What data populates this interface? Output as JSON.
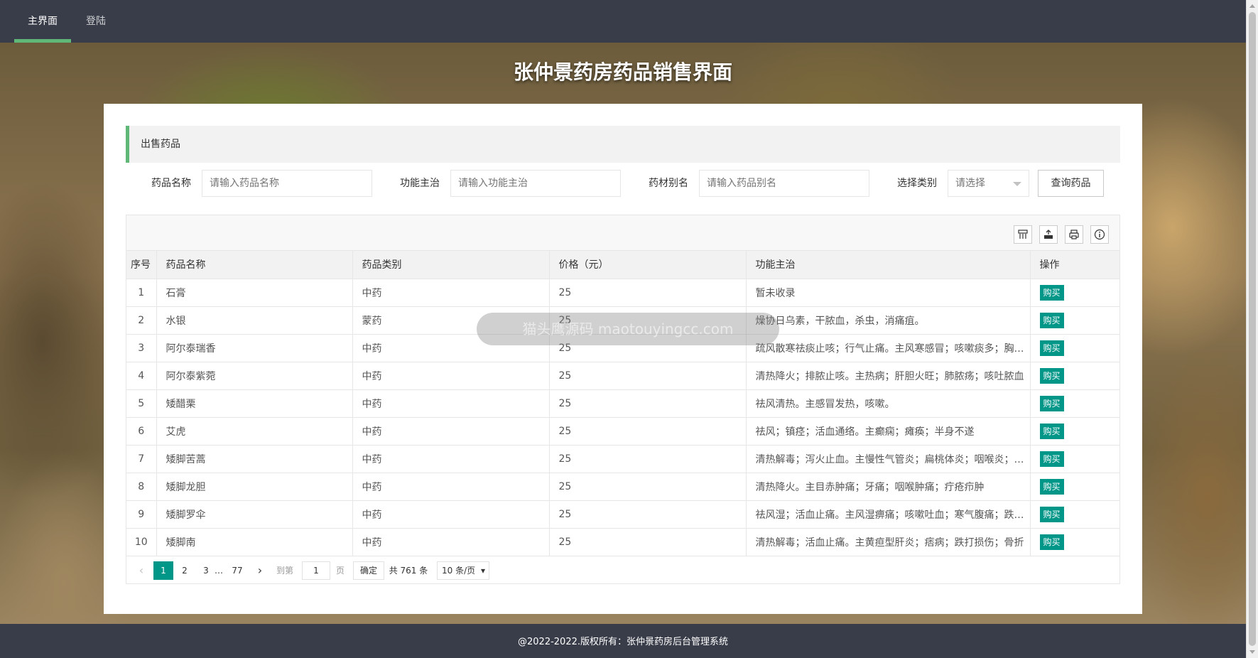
{
  "nav": {
    "items": [
      {
        "label": "主界面",
        "active": true
      },
      {
        "label": "登陆",
        "active": false
      }
    ],
    "active_color": "#5fb878"
  },
  "page": {
    "title": "张仲景药房药品销售界面"
  },
  "section": {
    "title": "出售药品"
  },
  "search": {
    "name_label": "药品名称",
    "name_placeholder": "请输入药品名称",
    "function_label": "功能主治",
    "function_placeholder": "请输入功能主治",
    "alias_label": "药材别名",
    "alias_placeholder": "请输入药品别名",
    "category_label": "选择类别",
    "category_value": "请选择",
    "query_button": "查询药品"
  },
  "toolbar": {
    "icons": [
      "columns-filter-icon",
      "export-icon",
      "print-icon",
      "info-icon"
    ]
  },
  "table": {
    "headers": [
      "序号",
      "药品名称",
      "药品类别",
      "价格（元）",
      "功能主治",
      "操作"
    ],
    "buy_label": "购买",
    "buy_color": "#009688",
    "rows": [
      {
        "no": "1",
        "name": "石膏",
        "category": "中药",
        "price": "25",
        "function": "暂未收录"
      },
      {
        "no": "2",
        "name": "水银",
        "category": "蒙药",
        "price": "25",
        "function": "燥协日乌素，干脓血，杀虫，消痛疽。"
      },
      {
        "no": "3",
        "name": "阿尔泰瑞香",
        "category": "中药",
        "price": "25",
        "function": "疏风散寒祛痰止咳；行气止痛。主风寒感冒；咳嗽痰多；胸胁胀痛"
      },
      {
        "no": "4",
        "name": "阿尔泰紫菀",
        "category": "中药",
        "price": "25",
        "function": "清热降火；排脓止咳。主热病；肝胆火旺；肺脓疡；咳吐脓血"
      },
      {
        "no": "5",
        "name": "矮醋栗",
        "category": "中药",
        "price": "25",
        "function": "祛风清热。主感冒发热，咳嗽。"
      },
      {
        "no": "6",
        "name": "艾虎",
        "category": "中药",
        "price": "25",
        "function": "祛风；镇痉；活血通络。主癫痫；瘫痪；半身不遂"
      },
      {
        "no": "7",
        "name": "矮脚苦蒿",
        "category": "中药",
        "price": "25",
        "function": "清热解毒；泻火止血。主慢性气管炎；扁桃体炎；咽喉炎；鼻出血"
      },
      {
        "no": "8",
        "name": "矮脚龙胆",
        "category": "中药",
        "price": "25",
        "function": "清热降火。主目赤肿痛；牙痛；咽喉肿痛；疔疮疖肿"
      },
      {
        "no": "9",
        "name": "矮脚罗伞",
        "category": "中药",
        "price": "25",
        "function": "祛风湿；活血止痛。主风湿痹痛；咳嗽吐血；寒气腹痛；跌打损伤"
      },
      {
        "no": "10",
        "name": "矮脚南",
        "category": "中药",
        "price": "25",
        "function": "清热解毒；活血止痛。主黄疸型肝炎；痞病；跌打损伤；骨折"
      }
    ]
  },
  "pagination": {
    "prev": "‹",
    "pages": [
      "1",
      "2",
      "3"
    ],
    "ellipsis": "…",
    "last": "77",
    "next": "›",
    "goto_label": "到第",
    "goto_value": "1",
    "page_unit": "页",
    "confirm": "确定",
    "total": "共 761 条",
    "per_page": "10 条/页"
  },
  "watermark": {
    "text": "猫头鹰源码 maotouyingcc.com"
  },
  "footer": {
    "text": "@2022-2022.版权所有：张仲景药房后台管理系统"
  }
}
